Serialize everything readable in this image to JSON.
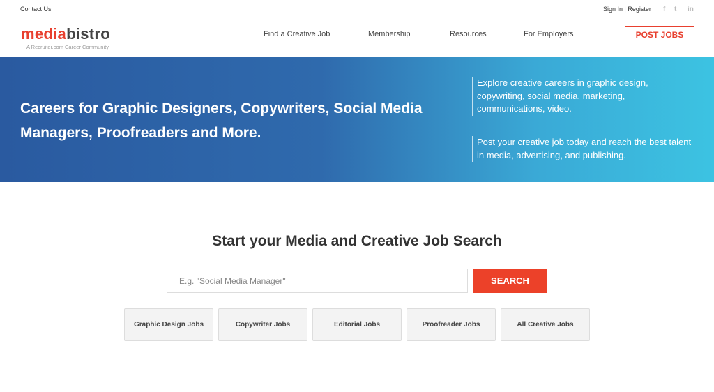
{
  "topbar": {
    "contact": "Contact Us",
    "sign_in": "Sign In",
    "separator": "|",
    "register": "Register",
    "social": [
      {
        "icon": "facebook-icon",
        "glyph": "f"
      },
      {
        "icon": "twitter-icon",
        "glyph": "t"
      },
      {
        "icon": "linkedin-icon",
        "glyph": "in"
      }
    ]
  },
  "logo": {
    "part1": "media",
    "part2": "bistro",
    "tagline": "A Recruiter.com Career Community"
  },
  "nav": [
    "Find a Creative Job",
    "Membership",
    "Resources",
    "For Employers"
  ],
  "post_jobs": "POST JOBS",
  "hero": {
    "headline": "Careers for Graphic Designers, Copywriters, Social Media Managers, Proofreaders and More.",
    "blurb1": "Explore creative careers in graphic design, copywriting, social media, marketing, communications, video.",
    "blurb2": "Post your creative job today and reach the best talent in media, advertising, and publishing."
  },
  "search": {
    "title": "Start your Media and Creative Job Search",
    "placeholder": "E.g. \"Social Media Manager\"",
    "value": "",
    "button": "SEARCH"
  },
  "categories": [
    "Graphic Design Jobs",
    "Copywriter Jobs",
    "Editorial Jobs",
    "Proofreader Jobs",
    "All Creative Jobs"
  ],
  "colors": {
    "accent": "#e8402f",
    "hero_start": "#2a5aa0",
    "hero_end": "#3cc3e2"
  }
}
